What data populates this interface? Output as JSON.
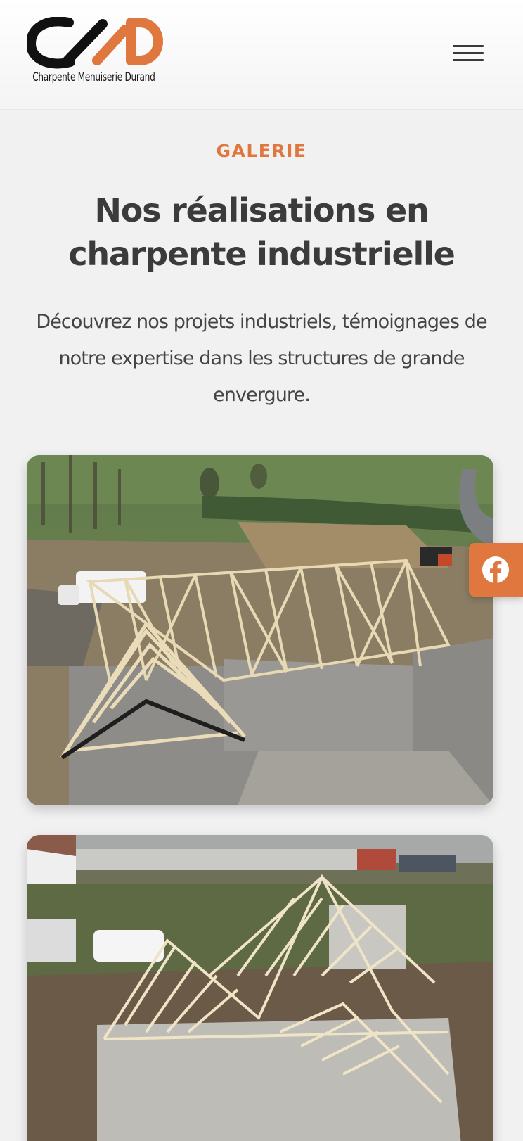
{
  "header": {
    "logo_text": "Charpente Menuiserie Durand",
    "menu_icon": "hamburger-menu-icon"
  },
  "intro": {
    "eyebrow": "GALERIE",
    "title": "Nos réalisations en charpente industrielle",
    "subtitle": "Découvrez nos projets industriels, témoignages de notre expertise dans les structures de grande envergure."
  },
  "social": {
    "facebook_icon": "facebook-icon",
    "color": "#e0773f"
  },
  "colors": {
    "accent": "#e0773f",
    "background": "#f1f1f2",
    "text": "#3b3b3b"
  }
}
